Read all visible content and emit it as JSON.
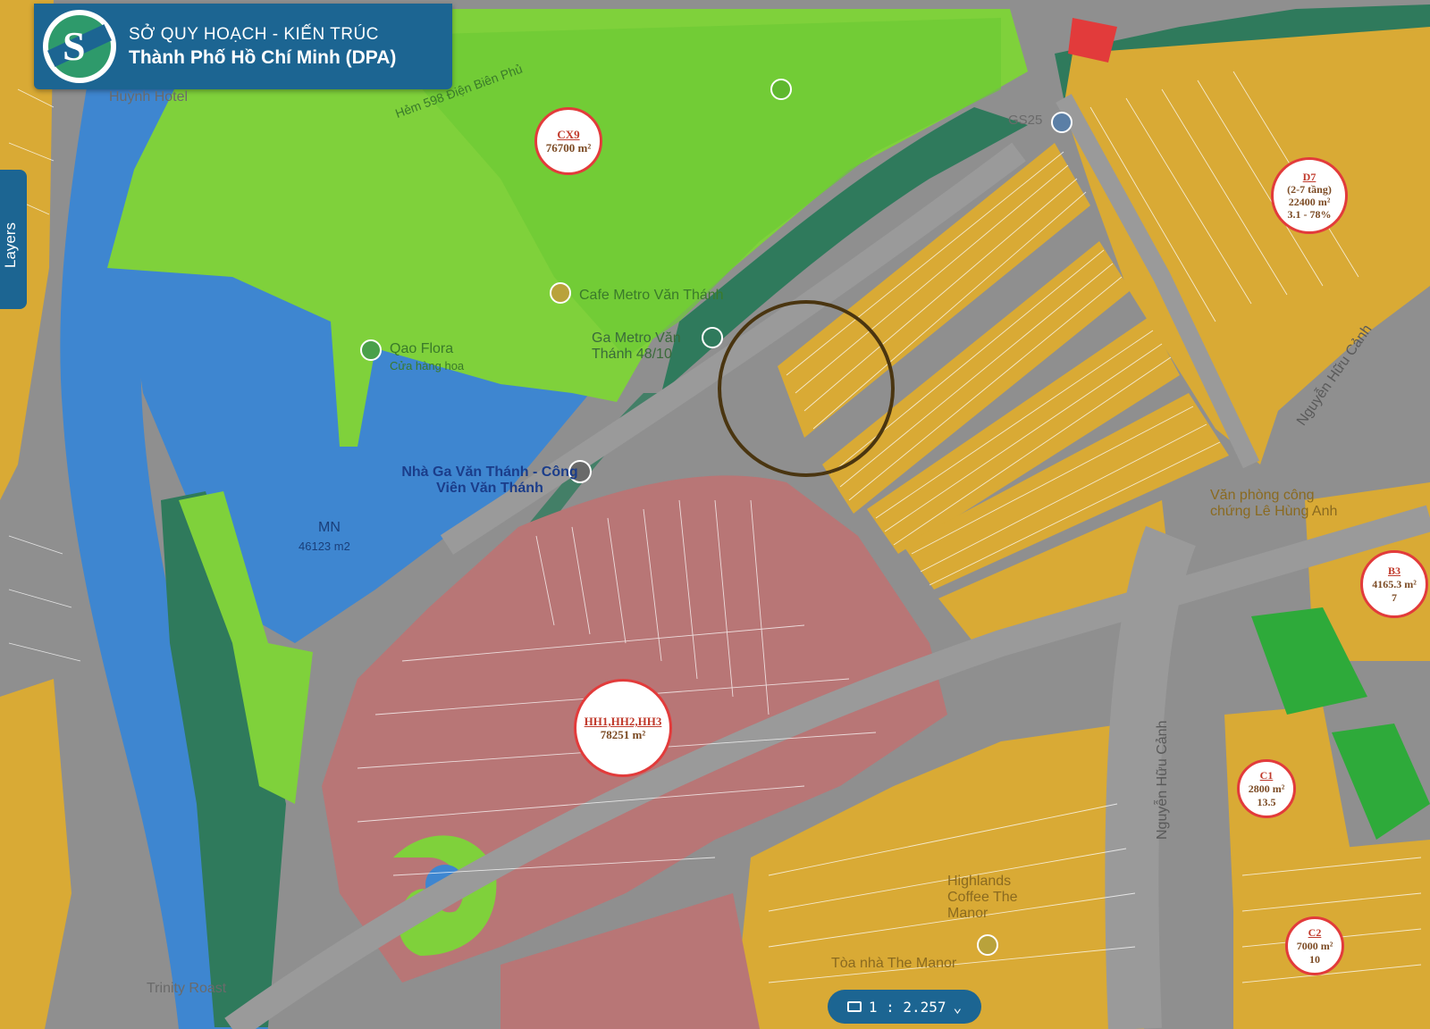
{
  "header": {
    "line1": "SỞ QUY HOẠCH - KIẾN TRÚC",
    "line2": "Thành Phố Hồ Chí Minh (DPA)"
  },
  "layers_label": "Layers",
  "places": {
    "huynh_hotel": "Huỳnh Hotel",
    "hem_598": "Hẻm 598 Điện Biên Phủ",
    "cafe_metro": "Cafe Metro Văn Thánh",
    "qao_flora": "Qao Flora",
    "cua_hang_hoa": "Cửa hàng hoa",
    "ga_metro": "Ga Metro Văn Thánh 48/10",
    "nha_ga": "Nhà Ga Văn Thánh - Công Viên Văn Thánh",
    "highlands": "Highlands Coffee The Manor",
    "toa_nha": "Tòa nhà The Manor",
    "trinity": "Trinity Roast",
    "nguyen_huu_canh": "Nguyễn Hữu Cảnh",
    "van_phong": "Văn phòng công chứng Lê Hùng Anh",
    "gs25": "GS25"
  },
  "zones": {
    "mn": {
      "code": "MN",
      "area": "46123 m2"
    },
    "cx9": {
      "code": "CX9",
      "area": "76700 m²"
    },
    "d7": {
      "code": "D7",
      "floors": "(2-7 tầng)",
      "area": "22400 m²",
      "density": "3.1 - 78%"
    },
    "hh": {
      "code": "HH1,HH2,HH3",
      "area": "78251 m²"
    },
    "b3": {
      "code": "B3",
      "area": "4165.3 m²",
      "extra": "7"
    },
    "c1": {
      "code": "C1",
      "area": "2800 m²",
      "extra": "13.5"
    },
    "c2": {
      "code": "C2",
      "area": "7000 m²",
      "extra": "10"
    }
  },
  "scale": {
    "label": "1 : 2.257"
  },
  "colors": {
    "park_light": "#7fd13b",
    "park_mid": "#55c13a",
    "water": "#3e86d0",
    "road": "#8f8f8f",
    "residential": "#d9aa35",
    "mixed_use": "#b87676",
    "tree_band": "#2f7a5c",
    "accent_red": "#e23b3b",
    "header_blue": "#1c6592"
  },
  "icons": [
    "scale-icon",
    "chevron-down-icon",
    "metro-station-icon",
    "cafe-icon",
    "shop-icon",
    "tree-icon",
    "highlighted-circle"
  ]
}
